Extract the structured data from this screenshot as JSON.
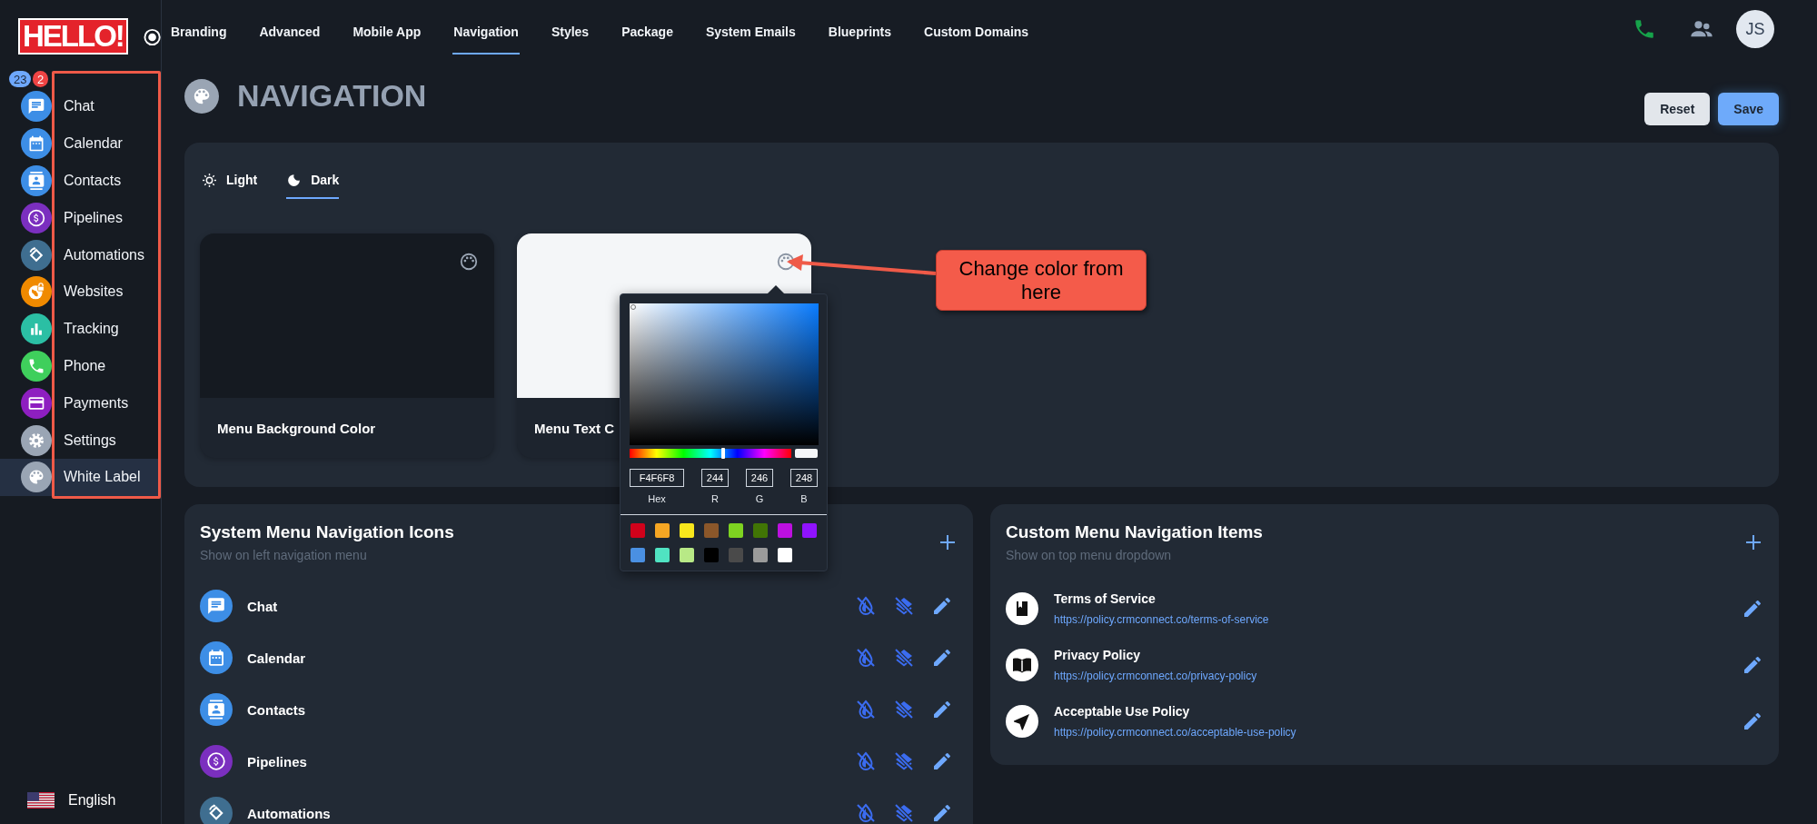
{
  "sidebar": {
    "logo": "HELLO!",
    "badges": [
      {
        "text": "23",
        "kind": "count"
      },
      {
        "text": "2",
        "kind": "alert"
      }
    ],
    "items": [
      {
        "label": "Chat",
        "kind": "chat",
        "color": "#3d8ee6",
        "selected": false
      },
      {
        "label": "Calendar",
        "kind": "calendar",
        "color": "#3d8ee6",
        "selected": false
      },
      {
        "label": "Contacts",
        "kind": "contacts",
        "color": "#3d8ee6",
        "selected": false
      },
      {
        "label": "Pipelines",
        "kind": "dollar",
        "color": "#7b2fbf",
        "selected": false
      },
      {
        "label": "Automations",
        "kind": "rotate",
        "color": "#3f6e90",
        "selected": false
      },
      {
        "label": "Websites",
        "kind": "globe",
        "color": "#f08a00",
        "selected": false
      },
      {
        "label": "Tracking",
        "kind": "chart",
        "color": "#2bbfa4",
        "selected": false
      },
      {
        "label": "Phone",
        "kind": "phone",
        "color": "#3fcf5c",
        "selected": false
      },
      {
        "label": "Payments",
        "kind": "card",
        "color": "#8e1fc0",
        "selected": false
      },
      {
        "label": "Settings",
        "kind": "gear",
        "color": "#9aa5b4",
        "selected": false
      },
      {
        "label": "White Label",
        "kind": "palette",
        "color": "#9aa5b4",
        "selected": true
      }
    ],
    "language": "English"
  },
  "tabs": [
    {
      "label": "Branding",
      "selected": false
    },
    {
      "label": "Advanced",
      "selected": false
    },
    {
      "label": "Mobile App",
      "selected": false
    },
    {
      "label": "Navigation",
      "selected": true
    },
    {
      "label": "Styles",
      "selected": false
    },
    {
      "label": "Package",
      "selected": false
    },
    {
      "label": "System Emails",
      "selected": false
    },
    {
      "label": "Blueprints",
      "selected": false
    },
    {
      "label": "Custom Domains",
      "selected": false
    }
  ],
  "user": {
    "avatar": "JS"
  },
  "header": {
    "title": "NAVIGATION",
    "buttons": [
      {
        "label": "Reset",
        "kind": "secondary"
      },
      {
        "label": "Save",
        "kind": "primary"
      }
    ]
  },
  "theme": {
    "modes": [
      {
        "label": "Light",
        "kind": "sun",
        "selected": false
      },
      {
        "label": "Dark",
        "kind": "moon",
        "selected": true
      }
    ],
    "cards": [
      {
        "label": "Menu Background Color",
        "color": "#151a21"
      },
      {
        "label": "Menu Text C",
        "color": "#f4f6f8"
      }
    ]
  },
  "color_picker": {
    "level": 0.58,
    "fields": [
      {
        "label": "Hex",
        "value": "F4F6F8",
        "kind": "hex"
      },
      {
        "label": "R",
        "value": "244",
        "kind": "channel"
      },
      {
        "label": "G",
        "value": "246",
        "kind": "channel"
      },
      {
        "label": "B",
        "value": "248",
        "kind": "channel"
      }
    ],
    "presets": [
      {
        "color": "#d0021b"
      },
      {
        "color": "#f5a623"
      },
      {
        "color": "#f8e71c"
      },
      {
        "color": "#8b572a"
      },
      {
        "color": "#7ed321"
      },
      {
        "color": "#417505"
      },
      {
        "color": "#bd10e0"
      },
      {
        "color": "#9013fe"
      },
      {
        "color": "#4a90e2"
      },
      {
        "color": "#50e3c2"
      },
      {
        "color": "#b8e986"
      },
      {
        "color": "#000000"
      },
      {
        "color": "#4a4a4a"
      },
      {
        "color": "#9b9b9b"
      },
      {
        "color": "#ffffff"
      }
    ]
  },
  "annotation": {
    "text": "Change color from here"
  },
  "system_menu": {
    "title": "System Menu Navigation Icons",
    "subtitle": "Show on left navigation menu",
    "items": [
      {
        "label": "Chat",
        "kind": "chat",
        "color": "#3d8ee6"
      },
      {
        "label": "Calendar",
        "kind": "calendar",
        "color": "#3d8ee6"
      },
      {
        "label": "Contacts",
        "kind": "contacts",
        "color": "#3d8ee6"
      },
      {
        "label": "Pipelines",
        "kind": "dollar",
        "color": "#7b2fbf"
      },
      {
        "label": "Automations",
        "kind": "rotate",
        "color": "#3f6e90"
      }
    ]
  },
  "custom_menu": {
    "title": "Custom Menu Navigation Items",
    "subtitle": "Show on top menu dropdown",
    "items": [
      {
        "title": "Terms of Service",
        "url": "https://policy.crmconnect.co/terms-of-service",
        "kind": "bookmark"
      },
      {
        "title": "Privacy Policy",
        "url": "https://policy.crmconnect.co/privacy-policy",
        "kind": "book"
      },
      {
        "title": "Acceptable Use Policy",
        "url": "https://policy.crmconnect.co/acceptable-use-policy",
        "kind": "navigation"
      }
    ]
  }
}
